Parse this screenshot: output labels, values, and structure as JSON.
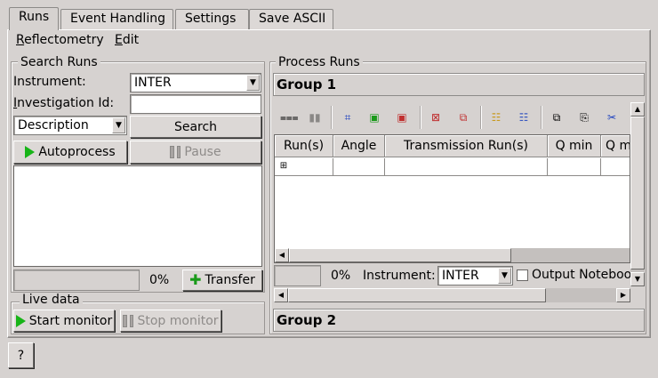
{
  "tabs": [
    "Runs",
    "Event Handling",
    "Settings",
    "Save ASCII"
  ],
  "menus": [
    {
      "label": "Reflectometry",
      "mnemonic": "R",
      "rest": "eflectometry"
    },
    {
      "label": "Edit",
      "mnemonic": "E",
      "rest": "dit"
    }
  ],
  "search_runs": {
    "title": "Search Runs",
    "instrument_label": "Instrument:",
    "instrument_value": "INTER",
    "investigation_label": "Investigation Id:",
    "investigation_value": "",
    "description_select": "Description",
    "search_button": "Search",
    "autoprocess_button": "Autoprocess",
    "pause_button": "Pause",
    "progress": 0,
    "progress_text": "0%",
    "transfer_button": "Transfer"
  },
  "live_data": {
    "title": "Live data",
    "start_button": "Start monitor",
    "stop_button": "Stop monitor"
  },
  "process_runs": {
    "title": "Process Runs",
    "groups": [
      "Group 1",
      "Group 2"
    ],
    "toolbar_icons": [
      "process-icon",
      "pause-icon",
      "expand-all-icon",
      "new-group-icon",
      "delete-group-icon",
      "plot-icon",
      "plot-group-icon",
      "insert-row-icon",
      "insert-group-row-icon",
      "copy-icon",
      "paste-icon",
      "cut-icon"
    ],
    "columns": [
      "Run(s)",
      "Angle",
      "Transmission Run(s)",
      "Q min",
      "Q m"
    ],
    "progress": 0,
    "progress_text": "0%",
    "instrument_label": "Instrument:",
    "instrument_value": "INTER",
    "output_notebook_label": "Output Noteboo",
    "output_notebook_checked": false
  },
  "help_button": "?"
}
